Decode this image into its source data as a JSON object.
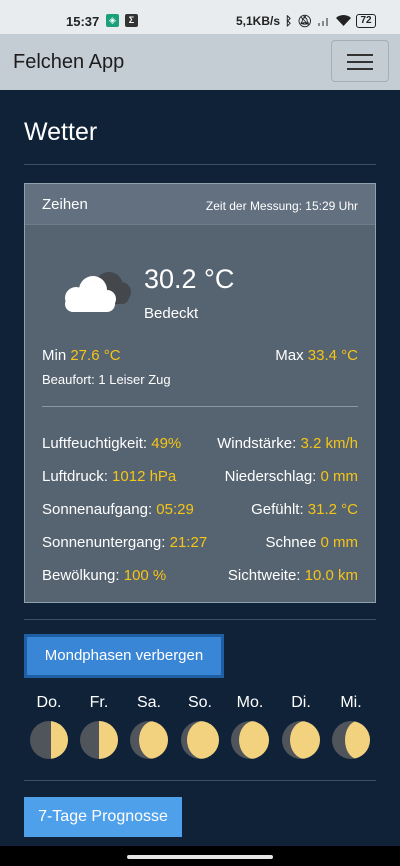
{
  "status": {
    "time": "15:37",
    "network_speed": "5,1KB/s",
    "battery": "72",
    "icons": [
      "shield-app-icon",
      "sigma-app-icon",
      "bluetooth-icon",
      "mute-icon",
      "signal-icon",
      "wifi-icon",
      "battery-icon"
    ]
  },
  "navbar": {
    "brand": "Felchen App",
    "menu_icon": "hamburger-icon"
  },
  "page": {
    "title": "Wetter"
  },
  "weather": {
    "location": "Zeihen",
    "measurement_time": "Zeit der Messung: 15:29 Uhr",
    "icon": "cloudy-icon",
    "temperature": "30.2 °C",
    "condition": "Bedeckt",
    "min_label": "Min",
    "min_value": "27.6 °C",
    "max_label": "Max",
    "max_value": "33.4 °C",
    "beaufort": "Beaufort: 1 Leiser Zug",
    "details": {
      "humidity_label": "Luftfeuchtigkeit:",
      "humidity": "49%",
      "wind_label": "Windstärke:",
      "wind": "3.2 km/h",
      "pressure_label": "Luftdruck:",
      "pressure": "1012 hPa",
      "precip_label": "Niederschlag:",
      "precip": "0 mm",
      "sunrise_label": "Sonnenaufgang:",
      "sunrise": "05:29",
      "feels_label": "Gefühlt:",
      "feels": "31.2 °C",
      "sunset_label": "Sonnenuntergang:",
      "sunset": "21:27",
      "snow_label": "Schnee",
      "snow": "0 mm",
      "clouds_label": "Bewölkung:",
      "clouds": "100 %",
      "visibility_label": "Sichtweite:",
      "visibility": "10.0 km"
    }
  },
  "moon": {
    "button_label": "Mondphasen verbergen",
    "days": [
      "Do.",
      "Fr.",
      "Sa.",
      "So.",
      "Mo.",
      "Di.",
      "Mi."
    ],
    "illumination": [
      0.45,
      0.5,
      0.75,
      0.85,
      0.8,
      0.8,
      0.65
    ]
  },
  "forecast": {
    "button_label": "7-Tage Prognosse"
  }
}
